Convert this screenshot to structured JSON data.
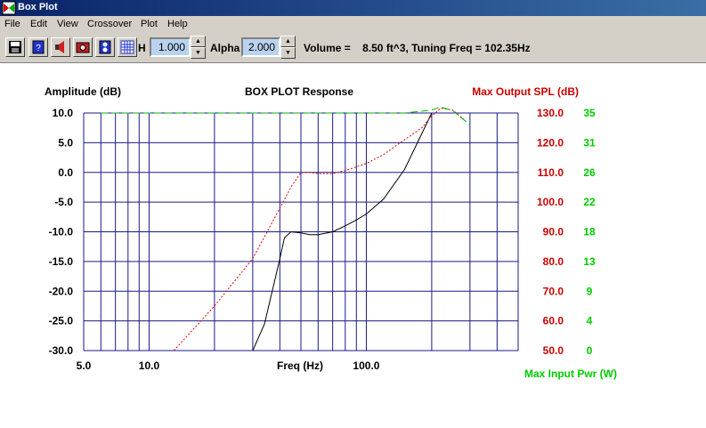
{
  "window": {
    "title": "Box Plot"
  },
  "menu": [
    "File",
    "Edit",
    "View",
    "Crossover",
    "Plot",
    "Help"
  ],
  "toolbar": {
    "icons": [
      "save-icon",
      "book-icon",
      "speaker-icon",
      "box-icon",
      "driver-icon",
      "grid-icon"
    ],
    "h_label": "H",
    "h_value": "1.000",
    "alpha_label": "Alpha",
    "alpha_value": "2.000",
    "status": "Volume =    8.50 ft^3, Tuning Freq = 102.35Hz"
  },
  "colors": {
    "left_axis": "#000000",
    "spl_axis": "#cc0000",
    "power_axis": "#00cc00",
    "grid": "#1a1a8c",
    "response_curve": "#000000",
    "spl_curve": "#dd0000",
    "power_curve": "#00bb00"
  },
  "chart_data": {
    "type": "line",
    "title": "BOX PLOT  Response",
    "ylabel_left": "Amplitude (dB)",
    "ylabel_right": "Max Output SPL (dB)",
    "xlabel": "Freq (Hz)",
    "xlabel_secondary": "Max Input Pwr (W)",
    "x_scale": "log",
    "xlim": [
      5,
      500
    ],
    "ylim": [
      -30,
      10
    ],
    "x_tick_labels": [
      "5.0",
      "10.0",
      "100.0"
    ],
    "x_tick_values": [
      5,
      10,
      100
    ],
    "y_ticks_left": [
      "10.0",
      "5.0",
      "0.0",
      "-5.0",
      "-10.0",
      "-15.0",
      "-20.0",
      "-25.0",
      "-30.0"
    ],
    "y_ticks_spl": [
      "130.0",
      "120.0",
      "110.0",
      "100.0",
      "90.0",
      "80.0",
      "70.0",
      "60.0",
      "50.0"
    ],
    "y_ticks_power": [
      "35",
      "31",
      "26",
      "22",
      "18",
      "13",
      "9",
      "4",
      "0"
    ],
    "grid": true,
    "series": [
      {
        "key": "response",
        "style": "solid",
        "x": [
          30,
          34,
          38,
          40,
          42,
          45,
          50,
          55,
          60,
          70,
          80,
          90,
          100,
          120,
          150,
          180,
          200
        ],
        "y": [
          -30,
          -25.5,
          -18,
          -14.5,
          -11,
          -10,
          -10.2,
          -10.5,
          -10.5,
          -10,
          -9,
          -8,
          -7,
          -4.5,
          0.5,
          6.5,
          10
        ]
      },
      {
        "key": "max_spl",
        "style": "dotted",
        "x": [
          13,
          20,
          30,
          40,
          45,
          50,
          55,
          60,
          70,
          80,
          100,
          120,
          150,
          180,
          200,
          220,
          250,
          280
        ],
        "y": [
          -30,
          -22.5,
          -14.5,
          -6,
          -2.5,
          0,
          0,
          -0.2,
          -0.2,
          0.3,
          1.5,
          3,
          5.5,
          7.5,
          9.5,
          10.8,
          10.5,
          9
        ]
      },
      {
        "key": "max_power",
        "style": "dashed",
        "x": [
          6,
          10,
          50,
          100,
          150,
          200,
          220,
          250,
          300
        ],
        "y": [
          10,
          10,
          10,
          10,
          10,
          10.5,
          11,
          10.4,
          8
        ]
      }
    ]
  }
}
